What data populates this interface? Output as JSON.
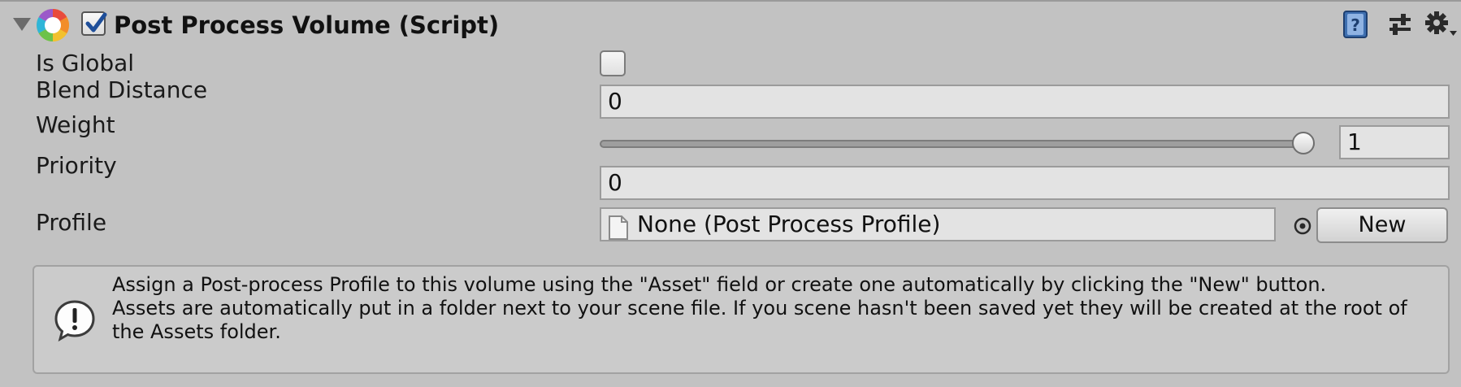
{
  "component": {
    "title": "Post Process Volume (Script)",
    "enabled": true,
    "icons": {
      "foldout": "foldout-expanded-icon",
      "component": "post-process-color-wheel-icon",
      "help": "help-book-icon",
      "presets": "presets-sliders-icon",
      "settings": "gear-icon"
    }
  },
  "fields": {
    "is_global": {
      "label": "Is Global",
      "checked": false
    },
    "blend_distance": {
      "label": "Blend Distance",
      "value": "0"
    },
    "weight": {
      "label": "Weight",
      "value": "1",
      "slider_fraction": 1.0,
      "min": 0,
      "max": 1
    },
    "priority": {
      "label": "Priority",
      "value": "0"
    },
    "profile": {
      "label": "Profile",
      "value": "None (Post Process Profile)",
      "new_label": "New"
    }
  },
  "helpbox": {
    "icon": "info-icon",
    "line1": "Assign a Post-process Profile to this volume using the \"Asset\" field or create one automatically by clicking the \"New\" button.",
    "line2": "Assets are automatically put in a folder next to your scene file. If you scene hasn't been saved yet they will be created at the root of the Assets folder."
  },
  "colors": {
    "panel_bg": "#c2c2c2",
    "field_bg": "#e3e3e3",
    "help_bg": "#cbcbcb",
    "help_icon_blue": "#3e6fb0"
  }
}
